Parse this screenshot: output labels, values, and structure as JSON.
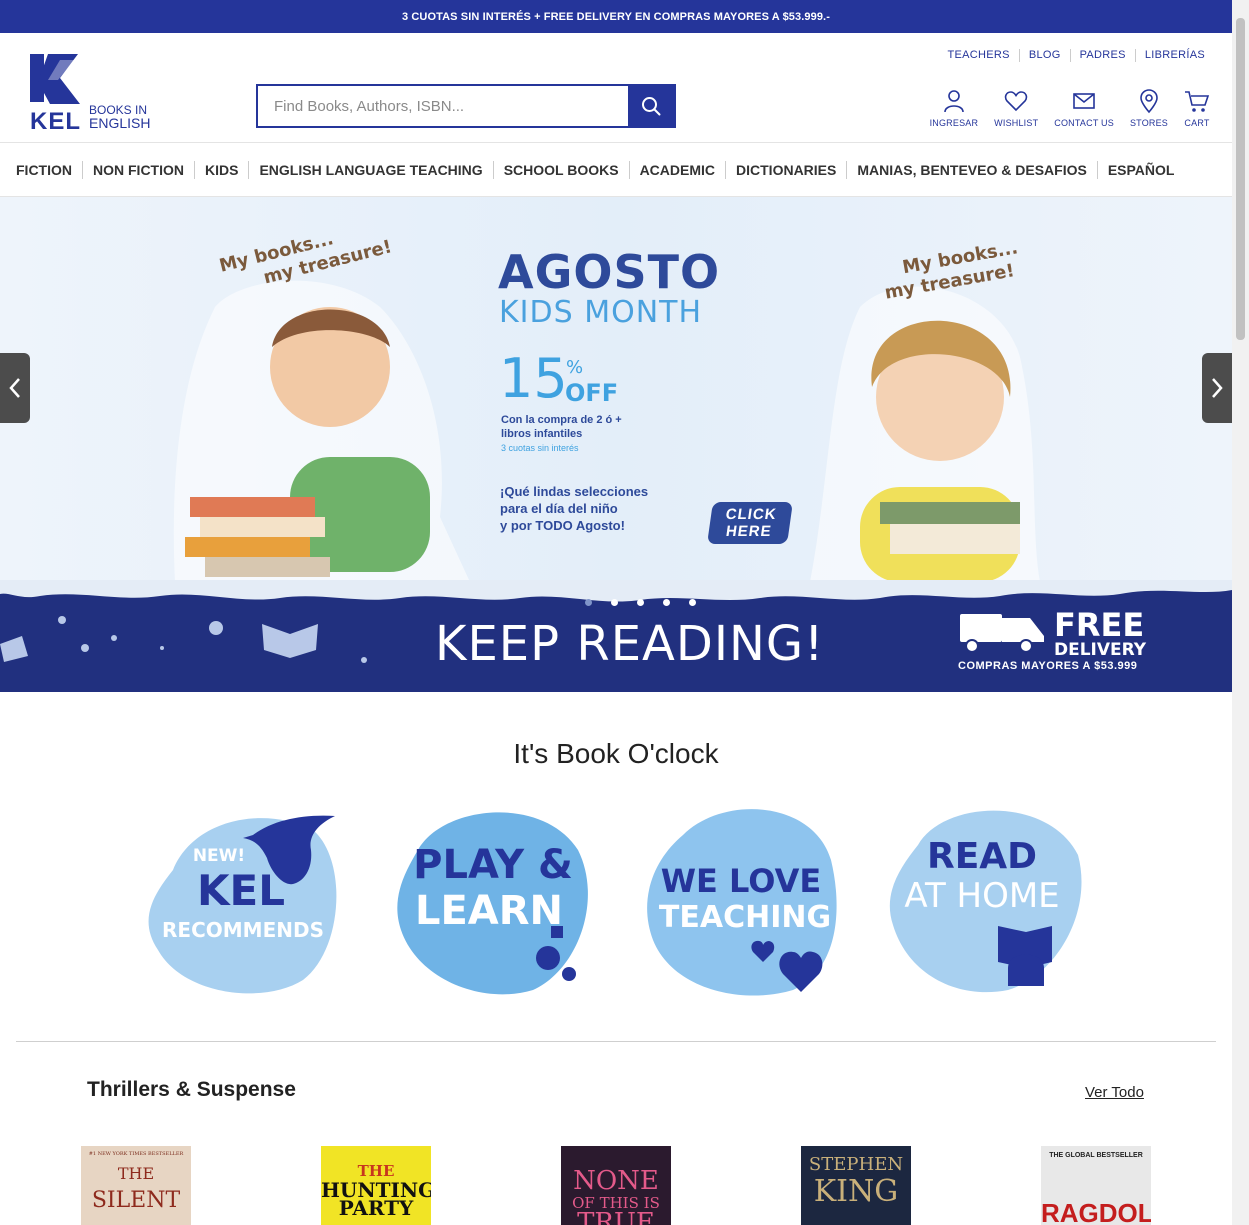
{
  "promo_bar": {
    "text": "3 CUOTAS SIN INTERÉS + FREE DELIVERY EN COMPRAS MAYORES A $53.999.-"
  },
  "logo": {
    "brand": "KEL",
    "tagline_line1": "BOOKS IN",
    "tagline_line2": "ENGLISH"
  },
  "search": {
    "placeholder": "Find Books, Authors, ISBN...",
    "value": ""
  },
  "top_links": [
    "TEACHERS",
    "BLOG",
    "PADRES",
    "LIBRERÍAS"
  ],
  "actions": [
    {
      "label": "INGRESAR",
      "icon": "user-icon"
    },
    {
      "label": "WISHLIST",
      "icon": "heart-icon"
    },
    {
      "label": "CONTACT US",
      "icon": "mail-icon"
    },
    {
      "label": "STORES",
      "icon": "location-pin-icon"
    },
    {
      "label": "CART",
      "icon": "cart-icon"
    }
  ],
  "nav": [
    "FICTION",
    "NON FICTION",
    "KIDS",
    "ENGLISH LANGUAGE TEACHING",
    "SCHOOL BOOKS",
    "ACADEMIC",
    "DICTIONARIES",
    "MANIAS, BENTEVEO & DESAFIOS",
    "ESPAÑOL"
  ],
  "banner": {
    "bubble_left_line1": "My books...",
    "bubble_left_line2": "my treasure!",
    "bubble_right_line1": "My books...",
    "bubble_right_line2": "my treasure!",
    "title": "AGOSTO",
    "subtitle": "KIDS MONTH",
    "discount": "15",
    "discount_percent": "%",
    "discount_off": "OFF",
    "condition_line1": "Con la compra de 2 ó +",
    "condition_line2": "libros infantiles",
    "condition_line3": "3 cuotas sin interés",
    "tagline_line1": "¡Qué lindas selecciones",
    "tagline_line2": "para el día del niño",
    "tagline_line3": "y por TODO Agosto!",
    "cta_line1": "CLICK",
    "cta_line2": "HERE",
    "keep_reading": "KEEP READING!",
    "free": "FREE",
    "delivery": "DELIVERY",
    "delivery_condition": "COMPRAS MAYORES A $53.999",
    "slide_count": 5,
    "active_slide": 1
  },
  "section": {
    "title": "It's Book O'clock"
  },
  "categories": [
    {
      "line1": "NEW!",
      "line2": "KEL",
      "line3": "RECOMMENDS"
    },
    {
      "line1": "PLAY &",
      "line2": "LEARN"
    },
    {
      "line1": "WE LOVE",
      "line2": "TEACHING"
    },
    {
      "line1": "READ",
      "line2": "AT HOME"
    }
  ],
  "book_row": {
    "title": "Thrillers & Suspense",
    "see_all": "Ver Todo"
  },
  "books": [
    {
      "title_line1": "THE",
      "title_line2": "SILENT",
      "top_text": "#1 NEW YORK TIMES BESTSELLER",
      "color": "#b53a2a"
    },
    {
      "title_line1": "THE",
      "title_line2": "HUNTING",
      "title_line3": "PARTY",
      "color": "#f1e425"
    },
    {
      "title_line1": "NONE",
      "title_line2": "OF THIS IS",
      "title_line3": "TRUE",
      "color": "#2b1a2e"
    },
    {
      "title_line1": "STEPHEN",
      "title_line2": "KING",
      "color": "#1c2740"
    },
    {
      "top_text": "THE GLOBAL BESTSELLER",
      "title_line1": "RAGDOLL",
      "color": "#e8e8e8"
    }
  ],
  "colors": {
    "brand": "#25359a",
    "banner_dark": "#21307f",
    "blob_light": "#a8d0f0",
    "blob_mid": "#6fb3e6"
  }
}
